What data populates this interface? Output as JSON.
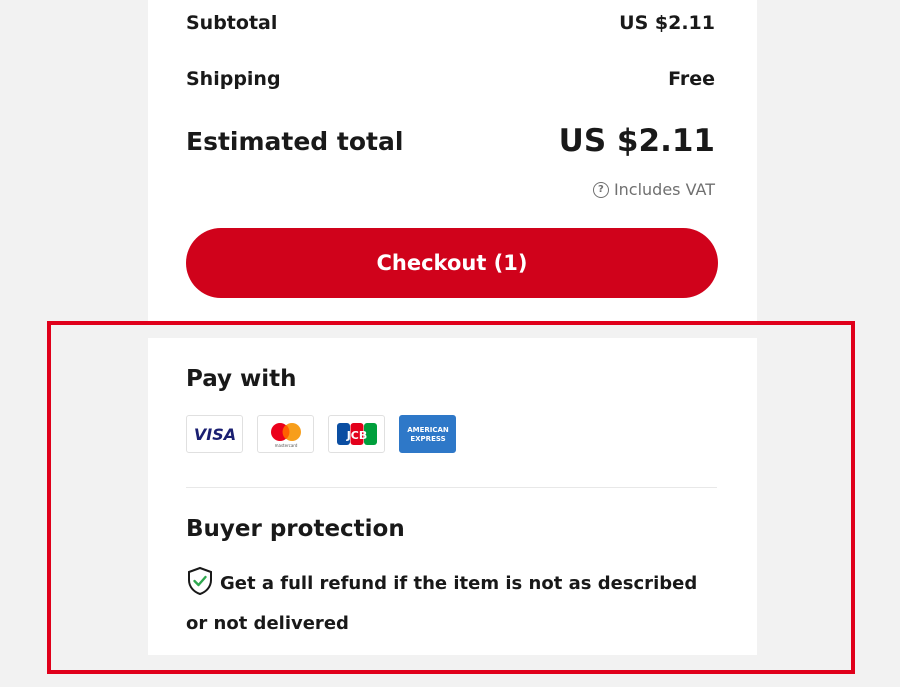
{
  "summary": {
    "subtotal_label": "Subtotal",
    "subtotal_value": "US $2.11",
    "shipping_label": "Shipping",
    "shipping_value": "Free",
    "total_label": "Estimated total",
    "total_value": "US $2.11",
    "vat_note": "Includes VAT",
    "checkout_label": "Checkout (1)"
  },
  "payment": {
    "title": "Pay with",
    "methods": [
      {
        "name": "VISA",
        "icon": "visa-icon"
      },
      {
        "name": "Mastercard",
        "icon": "mastercard-icon",
        "sub": "mastercard"
      },
      {
        "name": "JCB",
        "icon": "jcb-icon"
      },
      {
        "name": "American Express",
        "icon": "amex-icon",
        "line1": "AMERICAN",
        "line2": "EXPRESS"
      }
    ]
  },
  "buyer_protection": {
    "title": "Buyer protection",
    "text": "Get a full refund if the item is not as described or not delivered"
  },
  "colors": {
    "accent": "#d0021b",
    "highlight_border": "#e0001b",
    "page_bg": "#f2f2f2",
    "shield_check": "#2fa84f"
  }
}
